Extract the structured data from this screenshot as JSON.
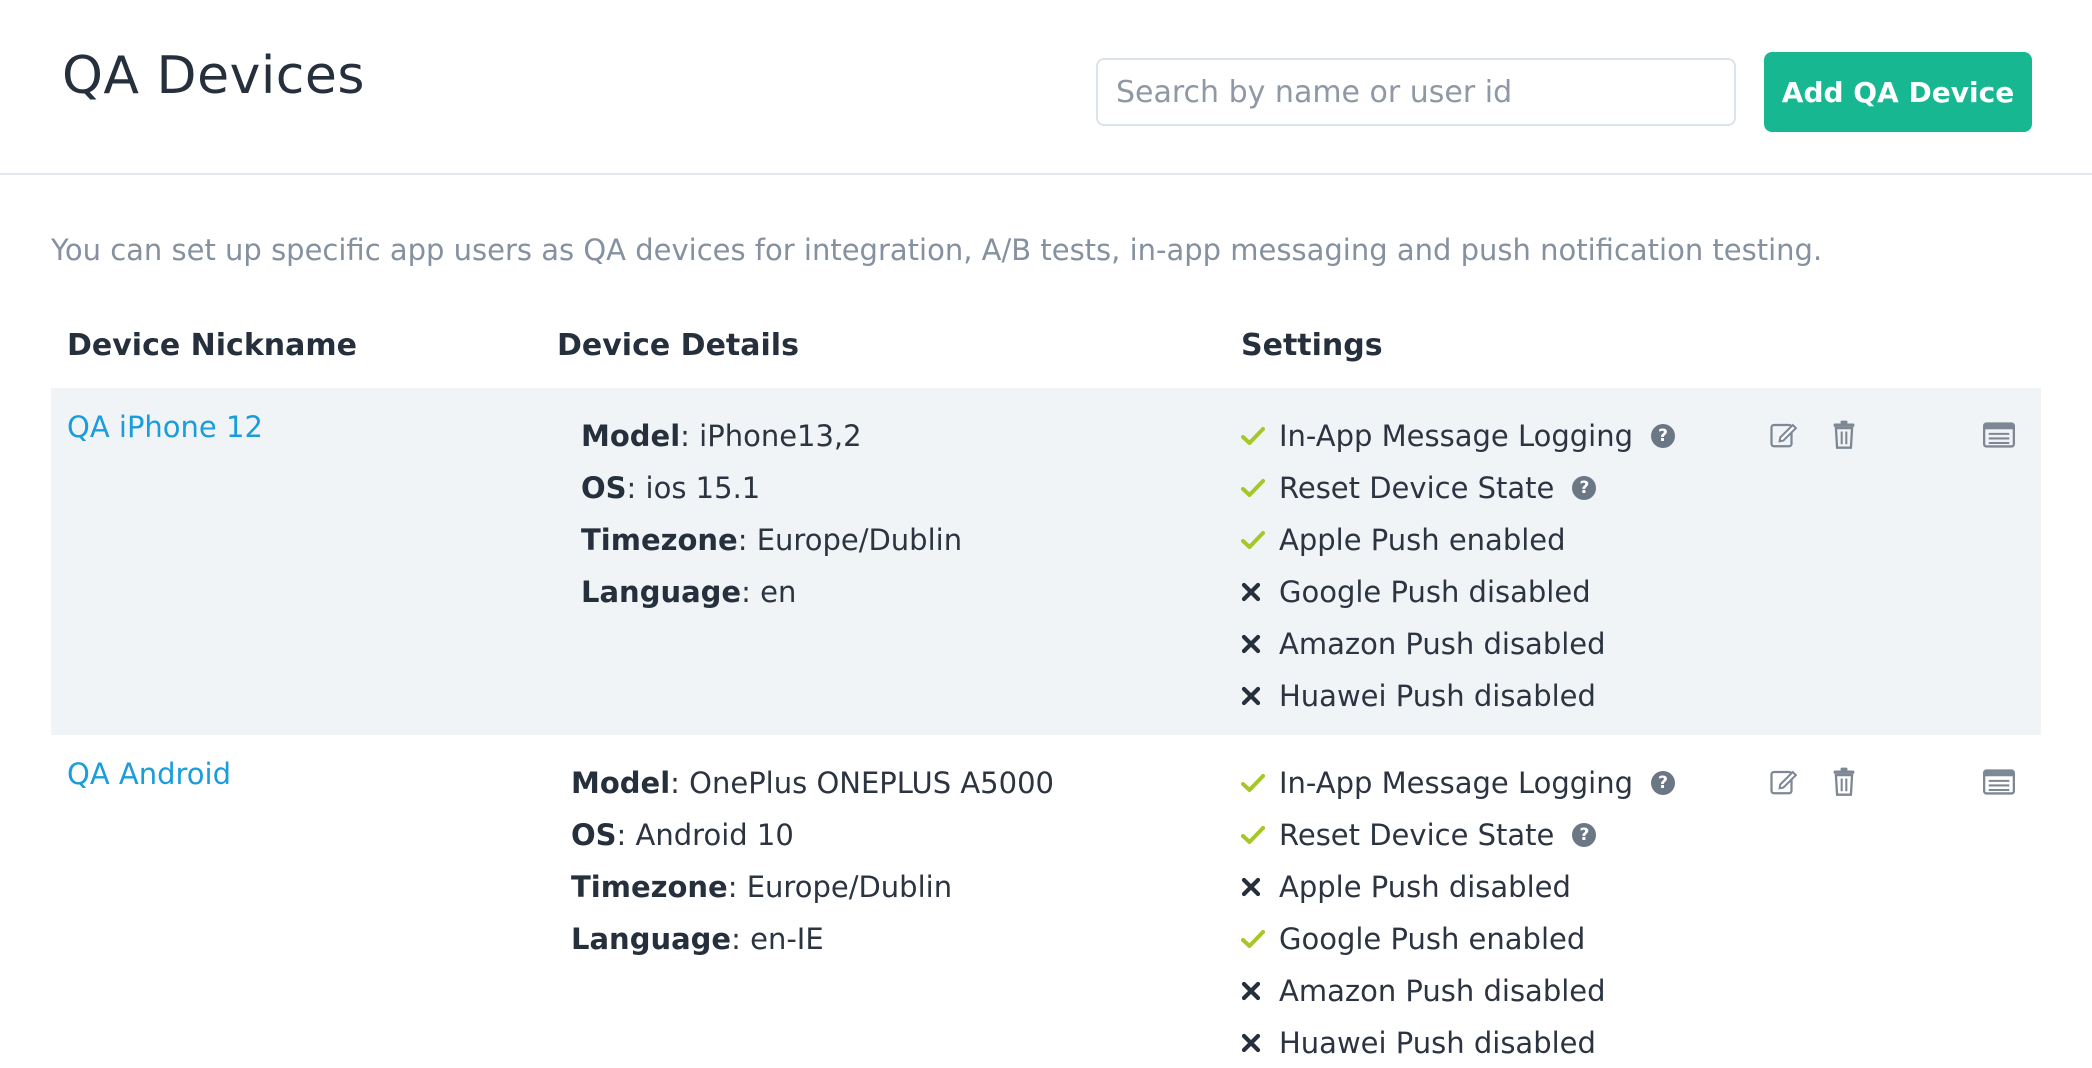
{
  "header": {
    "title": "QA Devices",
    "search_placeholder": "Search by name or user id",
    "add_button_label": "Add QA Device"
  },
  "description": "You can set up specific app users as QA devices for integration, A/B tests, in-app messaging and push notification testing.",
  "columns": {
    "nickname": "Device Nickname",
    "details": "Device Details",
    "settings": "Settings"
  },
  "colors": {
    "accent": "#17b891",
    "link": "#1a9ddb",
    "check": "#a6c728",
    "row_shade": "#f1f4f7"
  },
  "icons": [
    "check-icon",
    "cross-icon",
    "help-icon",
    "edit-icon",
    "trash-icon",
    "details-icon"
  ],
  "devices": [
    {
      "nickname": "QA iPhone 12",
      "details": [
        {
          "key": "Model",
          "value": ": iPhone13,2"
        },
        {
          "key": "OS",
          "value": ": ios 15.1"
        },
        {
          "key": "Timezone",
          "value": ": Europe/Dublin"
        },
        {
          "key": "Language",
          "value": ": en"
        }
      ],
      "settings": [
        {
          "label": "In-App Message Logging",
          "enabled": true,
          "help": true
        },
        {
          "label": "Reset Device State",
          "enabled": true,
          "help": true
        },
        {
          "label": "Apple Push enabled",
          "enabled": true,
          "help": false
        },
        {
          "label": "Google Push disabled",
          "enabled": false,
          "help": false
        },
        {
          "label": "Amazon Push disabled",
          "enabled": false,
          "help": false
        },
        {
          "label": "Huawei Push disabled",
          "enabled": false,
          "help": false
        }
      ]
    },
    {
      "nickname": "QA Android",
      "details": [
        {
          "key": "Model",
          "value": ": OnePlus ONEPLUS A5000"
        },
        {
          "key": "OS",
          "value": ": Android 10"
        },
        {
          "key": "Timezone",
          "value": ": Europe/Dublin"
        },
        {
          "key": "Language",
          "value": ": en-IE"
        }
      ],
      "settings": [
        {
          "label": "In-App Message Logging",
          "enabled": true,
          "help": true
        },
        {
          "label": "Reset Device State",
          "enabled": true,
          "help": true
        },
        {
          "label": "Apple Push disabled",
          "enabled": false,
          "help": false
        },
        {
          "label": "Google Push enabled",
          "enabled": true,
          "help": false
        },
        {
          "label": "Amazon Push disabled",
          "enabled": false,
          "help": false
        },
        {
          "label": "Huawei Push disabled",
          "enabled": false,
          "help": false
        }
      ]
    }
  ]
}
